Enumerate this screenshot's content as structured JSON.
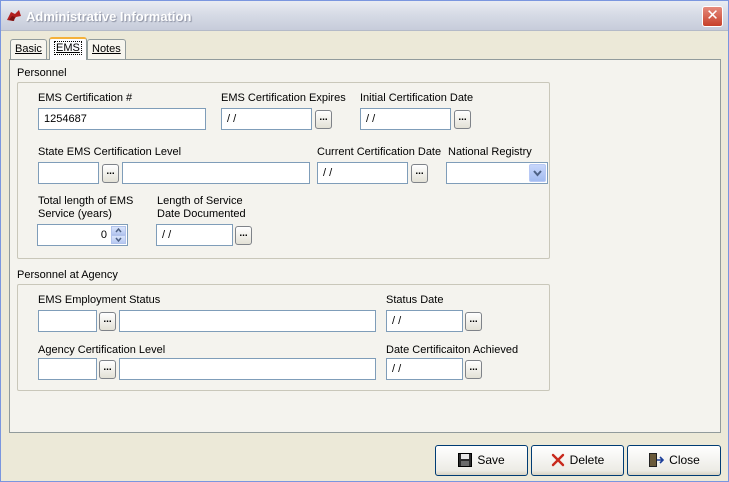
{
  "window": {
    "title": "Administrative Information",
    "close_glyph": "✕"
  },
  "tabs": [
    {
      "label": "Basic",
      "active": false
    },
    {
      "label": "EMS",
      "active": true
    },
    {
      "label": "Notes",
      "active": false
    }
  ],
  "personnel": {
    "group_label": "Personnel",
    "ems_cert_number": {
      "label": "EMS Certification #",
      "value": "1254687"
    },
    "ems_cert_expires": {
      "label": "EMS Certification Expires",
      "value": "/ /"
    },
    "initial_cert_date": {
      "label": "Initial Certification Date",
      "value": "/ /"
    },
    "state_ems_cert_level": {
      "label": "State EMS Certification Level",
      "code": "",
      "description": ""
    },
    "current_cert_date": {
      "label": "Current Certification Date",
      "value": "/ /"
    },
    "national_registry": {
      "label": "National Registry",
      "value": ""
    },
    "total_service": {
      "label_line1": "Total length of EMS",
      "label_line2": "Service (years)",
      "value": "0"
    },
    "service_documented": {
      "label_line1": "Length of Service",
      "label_line2": "Date Documented",
      "value": "/ /"
    }
  },
  "agency": {
    "group_label": "Personnel at Agency",
    "employment_status": {
      "label": "EMS Employment Status",
      "code": "",
      "description": ""
    },
    "status_date": {
      "label": "Status Date",
      "value": "/ /"
    },
    "agency_cert_level": {
      "label": "Agency Certification Level",
      "code": "",
      "description": ""
    },
    "date_cert_achieved": {
      "label": "Date Certificaiton Achieved",
      "value": "/ /"
    }
  },
  "ellipsis_label": "...",
  "buttons": {
    "save": "Save",
    "delete": "Delete",
    "close": "Close"
  },
  "icons": {
    "title": "app-icon",
    "save": "floppy-disk-icon",
    "delete": "red-x-icon",
    "close": "exit-door-icon"
  },
  "colors": {
    "tab_highlight": "#f5b13b",
    "field_border": "#7f9db9",
    "delete_icon": "#c8291c"
  }
}
